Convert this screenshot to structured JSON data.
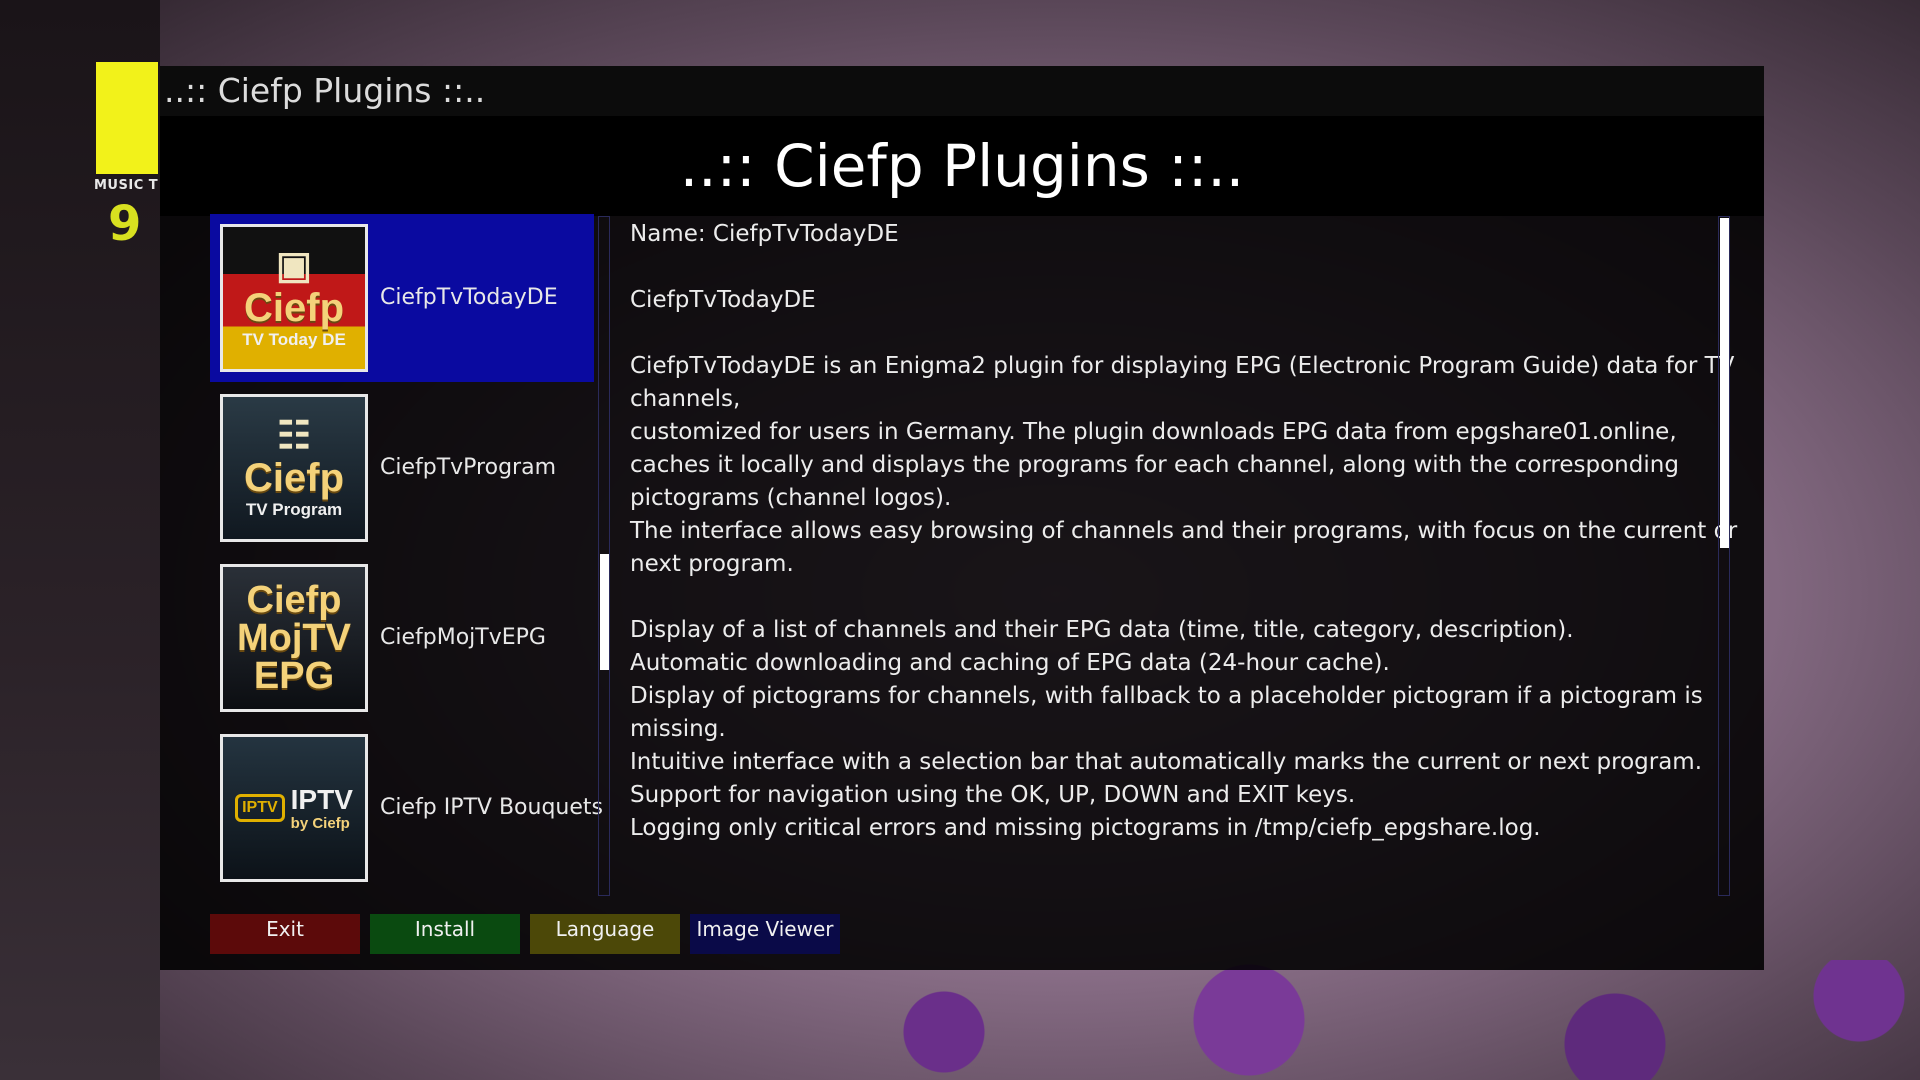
{
  "background": {
    "channel_logo_text": "MUSIC T",
    "channel_number": "9"
  },
  "window": {
    "title_bar": "..:: Ciefp Plugins ::..",
    "page_title": "..:: Ciefp Plugins ::.."
  },
  "plugins": [
    {
      "name": "CiefpTvTodayDE",
      "selected": true,
      "thumb": {
        "icon": "tv-today-icon",
        "brand": "Ciefp",
        "sub": "TV Today DE"
      }
    },
    {
      "name": "CiefpTvProgram",
      "selected": false,
      "thumb": {
        "icon": "tv-program-icon",
        "brand": "Ciefp",
        "sub": "TV Program"
      }
    },
    {
      "name": "CiefpMojTvEPG",
      "selected": false,
      "thumb": {
        "brand_l1": "Ciefp",
        "brand_l2": "MojTV",
        "brand_l3": "EPG"
      }
    },
    {
      "name": "Ciefp IPTV Bouquets",
      "selected": false,
      "thumb": {
        "box": "IPTV",
        "big": "IPTV",
        "by": "by Ciefp"
      }
    }
  ],
  "description": {
    "lines": [
      "Name: CiefpTvTodayDE",
      "",
      "CiefpTvTodayDE",
      "",
      "CiefpTvTodayDE is an Enigma2 plugin for displaying EPG (Electronic Program Guide) data for TV",
      "channels,",
      "customized for users in Germany. The plugin downloads EPG data from epgshare01.online,",
      "caches it locally and displays the programs for each channel, along with the corresponding",
      "pictograms (channel logos).",
      "The interface allows easy browsing of channels and their programs, with focus on the current or",
      "next program.",
      "",
      "Display of a list of channels and their EPG data (time, title, category, description).",
      "Automatic downloading and caching of EPG data (24-hour cache).",
      "Display of pictograms for channels, with fallback to a placeholder pictogram if a pictogram is",
      "missing.",
      "Intuitive interface with a selection bar that automatically marks the current or next program.",
      "Support for navigation using the OK, UP, DOWN and EXIT keys.",
      "Logging only critical errors and missing pictograms in /tmp/ciefp_epgshare.log."
    ]
  },
  "buttons": {
    "exit": "Exit",
    "install": "Install",
    "language": "Language",
    "image_viewer": "Image Viewer"
  },
  "colors": {
    "selection": "#0a0aa0",
    "red": "#5c0a0a",
    "green": "#0a4a10",
    "yellow": "#4c4808",
    "blue": "#0a0a48"
  }
}
